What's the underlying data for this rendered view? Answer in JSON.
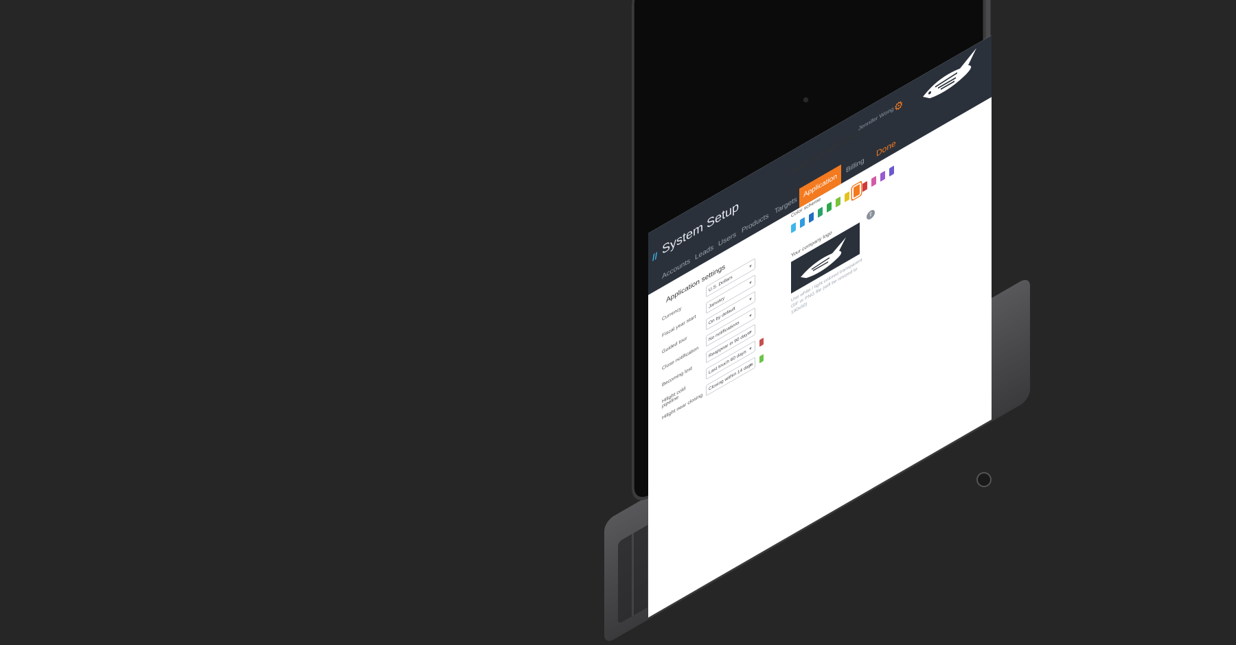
{
  "app": {
    "title": "System Setup",
    "logo_mark": "//",
    "user_name": "Jennifer Wong"
  },
  "nav": {
    "items": [
      {
        "label": "Accounts"
      },
      {
        "label": "Leads"
      },
      {
        "label": "Users"
      },
      {
        "label": "Products"
      },
      {
        "label": "Targets"
      },
      {
        "label": "Application"
      },
      {
        "label": "Billing"
      }
    ],
    "active": "Application",
    "done_label": "Done"
  },
  "settings": {
    "title": "Application settings",
    "rows": [
      {
        "label": "Currency",
        "value": "U.S. Dollars"
      },
      {
        "label": "Fiscal year start",
        "value": "January"
      },
      {
        "label": "Guided tour",
        "value": "On by default"
      },
      {
        "label": "Close notification",
        "value": "No notifications"
      },
      {
        "label": "Becoming lost",
        "value": "Reappear in 90 days"
      },
      {
        "label": "Hilight cold pipeline",
        "value": "Last touch 60 days"
      },
      {
        "label": "Hilight near closing",
        "value": "Closing within 14 days"
      }
    ],
    "row_colors": {
      "Becoming lost": "#c94f4f",
      "Hilight near closing": "#6cc24a"
    }
  },
  "appearance": {
    "title": "Application appearance",
    "color_scheme_label": "Color scheme",
    "colors": [
      "#3fb6ea",
      "#2f9be0",
      "#1f6fc2",
      "#2aa36b",
      "#2ea84a",
      "#7cc23a",
      "#e3c21d",
      "#f47a1f",
      "#d23a3a",
      "#d55aa6",
      "#9b59d0",
      "#6a5acd"
    ],
    "selected_color": "#f47a1f",
    "company_logo_label": "Your company logo",
    "logo_hint": "Use white / light colored transparent GIF or PNG file (will be resized to 190x50)"
  },
  "icons": {
    "gear": "gear-icon",
    "upload": "upload-icon"
  },
  "colors": {
    "accent": "#f47a1f",
    "topbar": "#2a313b",
    "background": "#262626"
  }
}
